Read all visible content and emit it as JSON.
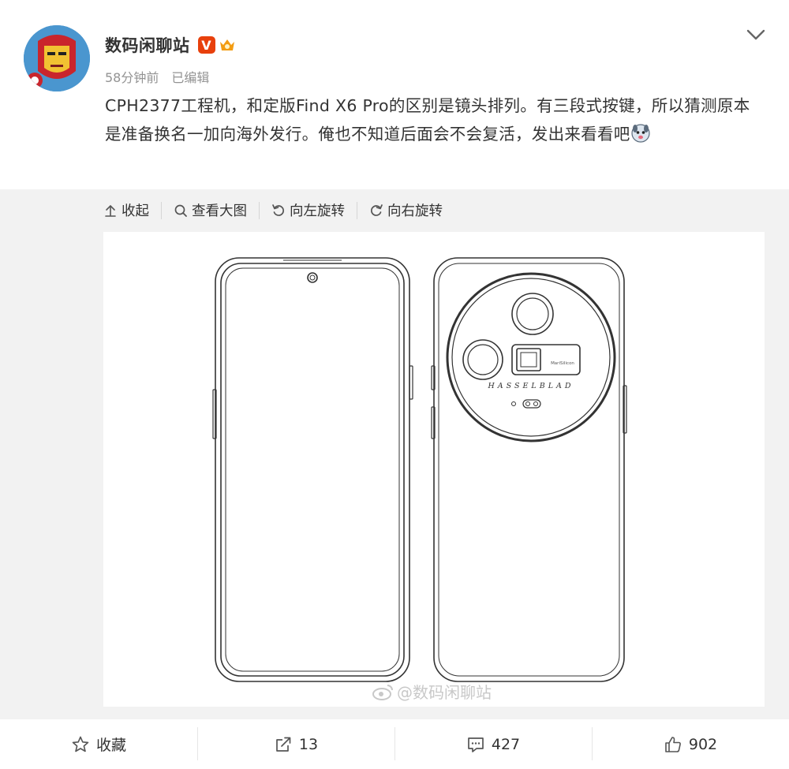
{
  "post": {
    "author": "数码闲聊站",
    "verified_badge": "V",
    "time": "58分钟前",
    "edited": "已编辑",
    "text": "CPH2377工程机，和定版Find X6 Pro的区别是镜头排列。有三段式按键，所以猜测原本是准备换名一加向海外发行。俺也不知道后面会不会复活，发出来看看吧"
  },
  "toolbar": {
    "collapse": "收起",
    "view_large": "查看大图",
    "rotate_left": "向左旋转",
    "rotate_right": "向右旋转"
  },
  "image": {
    "camera_brand": "HASSELBLAD",
    "chip_label": "MariSilicon",
    "watermark": "@数码闲聊站"
  },
  "footer": {
    "favorite": "收藏",
    "reposts": "13",
    "comments": "427",
    "likes": "902"
  },
  "colors": {
    "accent_badge": "#e8400c",
    "muted_text": "#939393",
    "media_bg": "#f2f2f2"
  },
  "icons": [
    "avatar-ironman",
    "verified-v-icon",
    "crown-badge-icon",
    "chevron-down-icon",
    "arrow-up-icon",
    "search-icon",
    "rotate-left-icon",
    "rotate-right-icon",
    "weibo-logo-icon",
    "star-icon",
    "share-icon",
    "comment-icon",
    "like-icon"
  ]
}
